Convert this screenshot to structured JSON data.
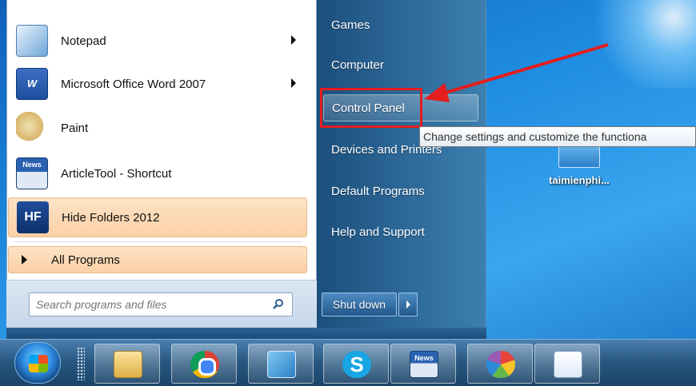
{
  "desktop": {
    "icon_label": "taimienphi..."
  },
  "start_menu": {
    "programs": [
      {
        "label": "Notepad",
        "icon": "notepad-icon",
        "has_submenu": true
      },
      {
        "label": "Microsoft Office Word 2007",
        "icon": "word-icon",
        "has_submenu": true
      },
      {
        "label": "Paint",
        "icon": "paint-icon",
        "has_submenu": false
      },
      {
        "label": "ArticleTool - Shortcut",
        "icon": "news-icon",
        "has_submenu": false
      },
      {
        "label": "Hide Folders 2012",
        "icon": "hide-folders-icon",
        "has_submenu": false
      }
    ],
    "all_programs_label": "All Programs",
    "search": {
      "placeholder": "Search programs and files",
      "value": ""
    },
    "right_items": [
      {
        "label": "Games"
      },
      {
        "label": "Computer"
      },
      {
        "label": "Control Panel"
      },
      {
        "label": "Devices and Printers"
      },
      {
        "label": "Default Programs"
      },
      {
        "label": "Help and Support"
      }
    ],
    "shutdown_label": "Shut down",
    "tooltip": "Change settings and customize the functiona"
  },
  "taskbar": {
    "buttons": [
      {
        "icon": "windows-explorer-icon"
      },
      {
        "icon": "chrome-icon"
      },
      {
        "icon": "photo-viewer-icon"
      },
      {
        "icon": "skype-icon",
        "glyph": "S"
      },
      {
        "icon": "news-icon",
        "glyph": "News"
      },
      {
        "icon": "colors-icon"
      },
      {
        "icon": "document-icon"
      }
    ]
  },
  "annotation": {
    "box_color": "#e41d1d",
    "arrow_color": "#e41d1d"
  }
}
